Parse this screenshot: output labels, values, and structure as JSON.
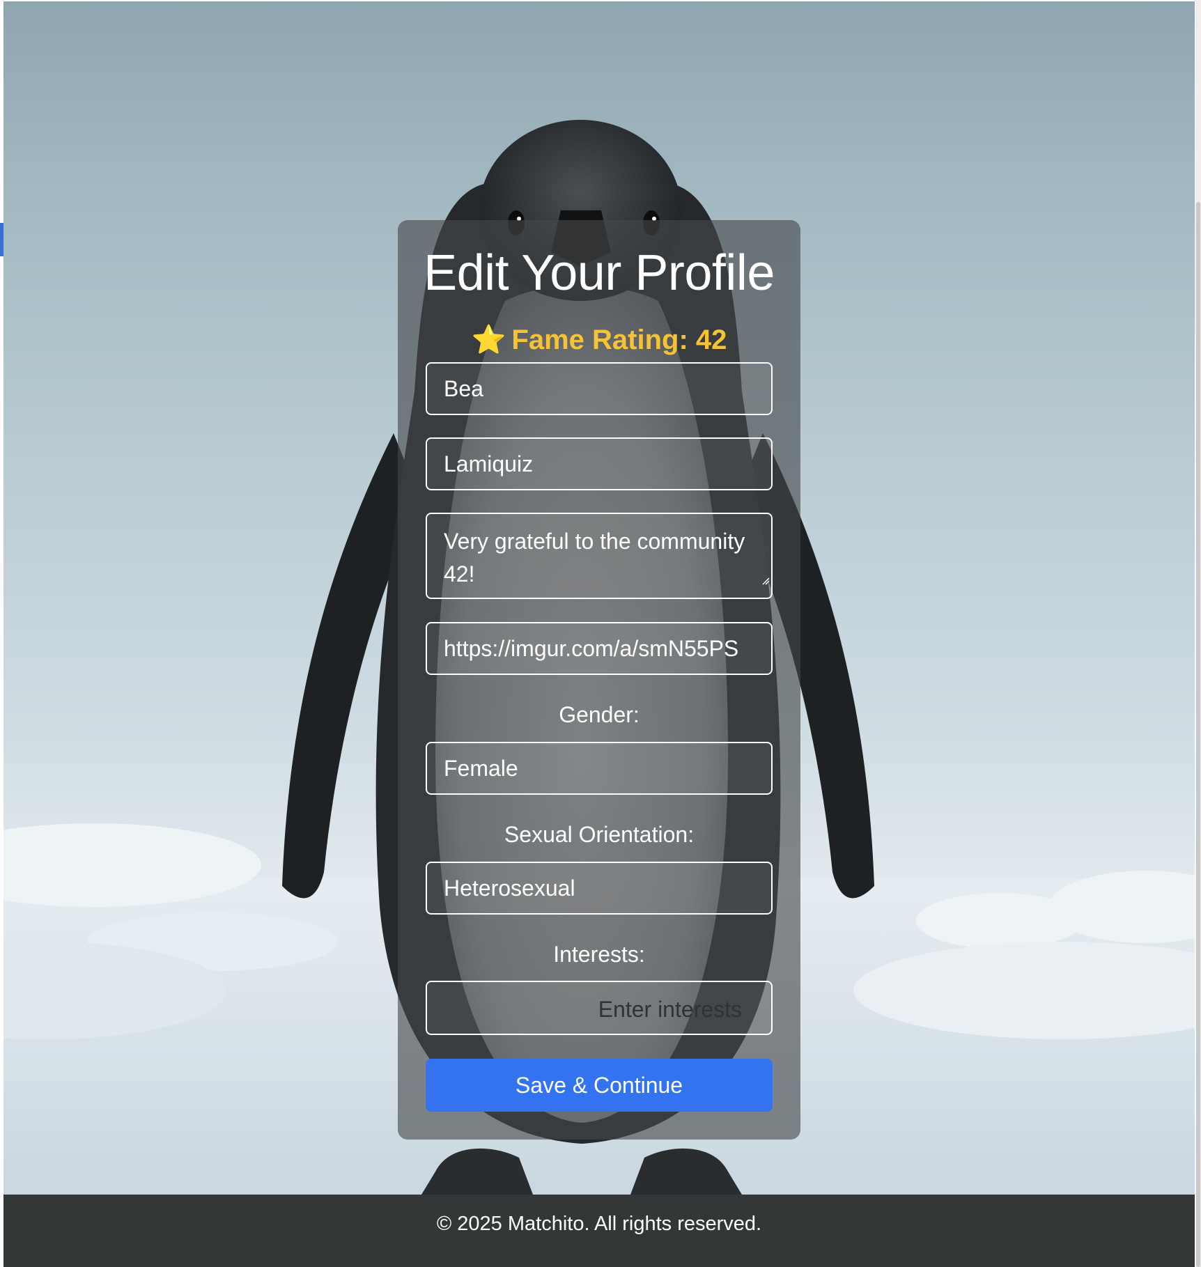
{
  "form": {
    "title": "Edit Your Profile",
    "fame_icon": "⭐",
    "fame_text": "Fame Rating: 42",
    "first_name": "Bea",
    "last_name": "Lamiquiz",
    "bio": "Very grateful to the community 42!",
    "picture_url": "https://imgur.com/a/smN55PS",
    "gender_label": "Gender:",
    "gender_value": "Female",
    "orientation_label": "Sexual Orientation:",
    "orientation_value": "Heterosexual",
    "interests_label": "Interests:",
    "interests_placeholder": "Enter interests",
    "save_label": "Save & Continue"
  },
  "footer": {
    "text": "© 2025 Matchito. All rights reserved."
  },
  "colors": {
    "accent": "#3473f0",
    "fame": "#f5c338",
    "footer_bg": "#343738"
  },
  "background": {
    "icon": "penguin-illustration"
  }
}
